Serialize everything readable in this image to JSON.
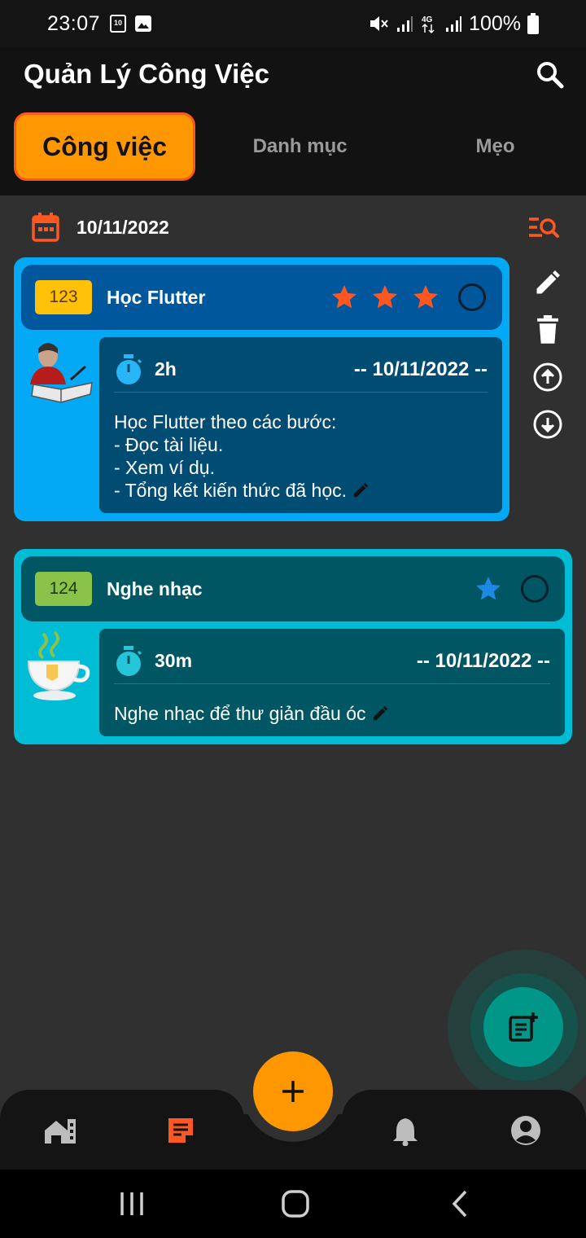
{
  "status_bar": {
    "time": "23:07",
    "calendar_day": "10",
    "battery": "100%",
    "icons": [
      "calendar-icon",
      "image-icon",
      "mute-icon",
      "signal-icon",
      "4g-icon",
      "battery-icon"
    ]
  },
  "app": {
    "title": "Quản Lý Công Việc"
  },
  "tabs": [
    {
      "label": "Công việc",
      "active": true
    },
    {
      "label": "Danh mục",
      "active": false
    },
    {
      "label": "Mẹo",
      "active": false
    }
  ],
  "date_filter": {
    "date": "10/11/2022"
  },
  "tasks": [
    {
      "id": "123",
      "title": "Học Flutter",
      "priority_stars": 3,
      "star_color": "#ff5722",
      "duration": "2h",
      "due": "-- 10/11/2022 --",
      "description": [
        "Học Flutter theo các bước:",
        "- Đọc tài liệu.",
        "- Xem ví dụ.",
        "- Tổng kết kiến thức đã học."
      ],
      "card_color": "#03a9f4",
      "head_color": "#01579b",
      "id_badge_color": "#ffc107"
    },
    {
      "id": "124",
      "title": "Nghe nhạc",
      "priority_stars": 1,
      "star_color": "#1e88e5",
      "duration": "30m",
      "due": "-- 10/11/2022 --",
      "description": [
        "Nghe nhạc để thư giản đầu óc"
      ],
      "card_color": "#00bcd4",
      "head_color": "#005662",
      "id_badge_color": "#8bc34a"
    }
  ],
  "actions": [
    "edit-icon",
    "delete-icon",
    "move-up-icon",
    "move-down-icon"
  ],
  "bottom_nav": [
    "home-icon",
    "tasks-icon",
    "notifications-icon",
    "account-icon"
  ],
  "colors": {
    "accent": "#ff9800",
    "accent_border": "#ff5722",
    "fab_teal": "#009688"
  }
}
